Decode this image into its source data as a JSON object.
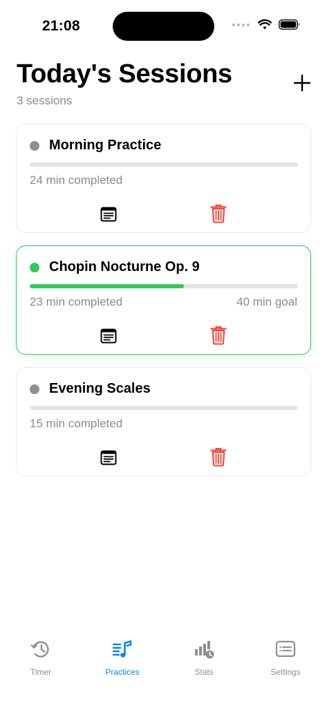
{
  "status_bar": {
    "time": "21:08"
  },
  "header": {
    "title": "Today's Sessions",
    "subtitle": "3 sessions",
    "add_icon": "plus-icon"
  },
  "colors": {
    "accent": "#0a84ff",
    "active_green": "#34c759",
    "delete_red": "#ff3b30",
    "inactive_dot": "#8e8e93"
  },
  "sessions": [
    {
      "title": "Morning Practice",
      "completed": "24 min completed",
      "goal": "",
      "progress": 0,
      "active": false,
      "notes_icon": "notes-icon",
      "delete_icon": "trash-icon"
    },
    {
      "title": "Chopin Nocturne Op. 9",
      "completed": "23 min completed",
      "goal": "40 min goal",
      "progress": 0.575,
      "active": true,
      "notes_icon": "notes-icon",
      "delete_icon": "trash-icon"
    },
    {
      "title": "Evening Scales",
      "completed": "15 min completed",
      "goal": "",
      "progress": 0,
      "active": false,
      "notes_icon": "notes-icon",
      "delete_icon": "trash-icon"
    }
  ],
  "tabs": [
    {
      "label": "Timer",
      "icon": "history-clock-icon",
      "selected": false
    },
    {
      "label": "Practices",
      "icon": "music-list-icon",
      "selected": true
    },
    {
      "label": "Stats",
      "icon": "chart-clock-icon",
      "selected": false
    },
    {
      "label": "Settings",
      "icon": "list-window-icon",
      "selected": false
    }
  ]
}
